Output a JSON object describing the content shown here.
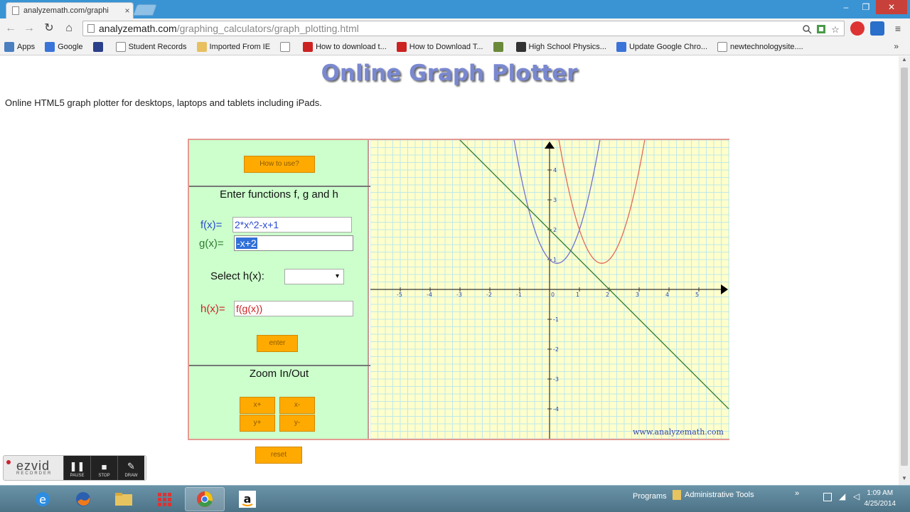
{
  "browser": {
    "tab_title": "analyzemath.com/graphi",
    "tab_close": "×",
    "url_domain": "analyzemath.com",
    "url_path": "/graphing_calculators/graph_plotting.html",
    "window_min": "–",
    "window_max": "❐",
    "window_close": "✕",
    "back": "←",
    "forward": "→",
    "reload": "↻",
    "home": "⌂"
  },
  "bookmarks": {
    "items": [
      {
        "label": "Apps",
        "color": "#4a7fc0"
      },
      {
        "label": "Google",
        "color": "#3b74d8"
      },
      {
        "label": "",
        "color": "#2b3f8a"
      },
      {
        "label": "Student Records",
        "color": "#ffffff"
      },
      {
        "label": "Imported From IE",
        "color": "#e8c060"
      },
      {
        "label": "",
        "color": "#ffffff"
      },
      {
        "label": "How to download t...",
        "color": "#cc2222"
      },
      {
        "label": "How to Download T...",
        "color": "#cc2222"
      },
      {
        "label": "",
        "color": "#6a8a3a"
      },
      {
        "label": "High School Physics...",
        "color": "#333333"
      },
      {
        "label": "Update Google Chro...",
        "color": "#3b74d8"
      },
      {
        "label": "newtechnologysite....",
        "color": "#ffffff"
      }
    ],
    "more": "»"
  },
  "page": {
    "title": "Online Graph Plotter",
    "subtitle": "Online HTML5 graph plotter for desktops, laptops and tablets including iPads."
  },
  "panel": {
    "how_to_use": "How to use?",
    "enter_heading": "Enter functions f, g and h",
    "f_label": "f(x)=",
    "f_value": "2*x^2-x+1",
    "g_label": "g(x)=",
    "g_value": "-x+2",
    "select_label": "Select h(x):",
    "select_arrow": "▾",
    "h_label": "h(x)=",
    "h_value": "f(g(x))",
    "enter": "enter",
    "zoom_heading": "Zoom In/Out",
    "x_plus": "x+",
    "x_minus": "x-",
    "y_plus": "y+",
    "y_minus": "y-",
    "reset": "reset"
  },
  "chart_data": {
    "type": "line",
    "title": "",
    "xlabel": "",
    "ylabel": "",
    "xlim": [
      -6,
      6
    ],
    "ylim": [
      -5,
      5
    ],
    "grid": true,
    "x_ticks": [
      -5,
      -4,
      -3,
      -2,
      -1,
      1,
      2,
      3,
      4,
      5
    ],
    "y_ticks": [
      -4,
      -3,
      -2,
      -1,
      1,
      2,
      3,
      4
    ],
    "series": [
      {
        "expr": "2*x^2-x+1",
        "color": "#7070d0"
      },
      {
        "expr": "-x+2",
        "color": "#2e7a2e"
      },
      {
        "expr": "f(g(x))",
        "color": "#e06a5a"
      }
    ],
    "watermark": "www.analyzemath.com",
    "colors": {
      "background": "#ffffcc",
      "grid": "#bfe8e8",
      "axis": "#333333"
    }
  },
  "recorder": {
    "logo": "ezvid",
    "logo_sub": "RECORDER",
    "pause": "PAUSE",
    "stop": "STOP",
    "draw": "DRAW"
  },
  "taskbar": {
    "tray_programs": "Programs",
    "tray_admin": "Administrative Tools",
    "time": "1:09 AM",
    "date": "4/25/2014"
  }
}
